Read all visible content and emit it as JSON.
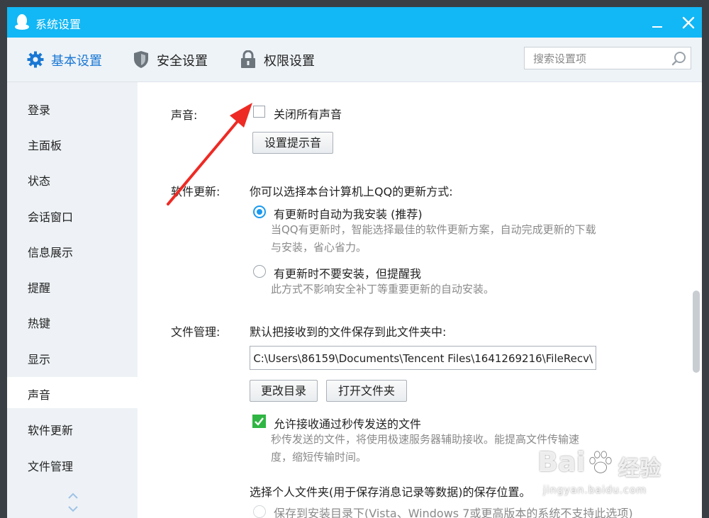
{
  "window": {
    "title": "系统设置"
  },
  "tabs": [
    {
      "label": "基本设置",
      "icon": "gear-icon",
      "active": true
    },
    {
      "label": "安全设置",
      "icon": "shield-icon",
      "active": false
    },
    {
      "label": "权限设置",
      "icon": "lock-icon",
      "active": false
    }
  ],
  "search": {
    "placeholder": "搜索设置项",
    "value": ""
  },
  "sidebar": {
    "items": [
      {
        "label": "登录"
      },
      {
        "label": "主面板"
      },
      {
        "label": "状态"
      },
      {
        "label": "会话窗口"
      },
      {
        "label": "信息展示"
      },
      {
        "label": "提醒"
      },
      {
        "label": "热键"
      },
      {
        "label": "显示"
      },
      {
        "label": "声音"
      },
      {
        "label": "软件更新"
      },
      {
        "label": "文件管理"
      }
    ],
    "active_index": 8
  },
  "sound": {
    "section_label": "声音:",
    "mute_all_label": "关闭所有声音",
    "mute_all_checked": false,
    "set_tone_button": "设置提示音"
  },
  "update": {
    "section_label": "软件更新:",
    "intro": "你可以选择本台计算机上QQ的更新方式:",
    "auto_label": "有更新时自动为我安装 (推荐)",
    "auto_checked": true,
    "auto_desc_line1": "当QQ有更新时，智能选择最佳的软件更新方案，自动完成更新的下载",
    "auto_desc_line2": "与安装，省心省力。",
    "notify_label": "有更新时不要安装，但提醒我",
    "notify_checked": false,
    "notify_desc": "此方式不影响安全补丁等重要更新的自动安装。"
  },
  "files": {
    "section_label": "文件管理:",
    "intro": "默认把接收到的文件保存到此文件夹中:",
    "path_value": "C:\\Users\\86159\\Documents\\Tencent Files\\1641269216\\FileRecv\\",
    "change_dir_button": "更改目录",
    "open_folder_button": "打开文件夹",
    "allow_fast_label": "允许接收通过秒传发送的文件",
    "allow_fast_checked": true,
    "fast_desc_line1": "秒传发送的文件，将使用极速服务器辅助接收。能提高文件传输速",
    "fast_desc_line2": "度，缩短传输时间。",
    "personal_folder_intro": "选择个人文件夹(用于保存消息记录等数据)的保存位置。",
    "install_dir_option": "保存到安装目录下(Vista、Windows 7或更高版本的系统不支持此选项)"
  },
  "watermark": {
    "line1": "Bai",
    "line2": "经验",
    "line3": "jingyan.baidu.com"
  },
  "colors": {
    "titlebar": "#12b7f5",
    "accent": "#1a78d4",
    "check_green": "#2fb543",
    "radio_blue": "#1a9af0",
    "annotation_arrow": "#ee2a24"
  }
}
